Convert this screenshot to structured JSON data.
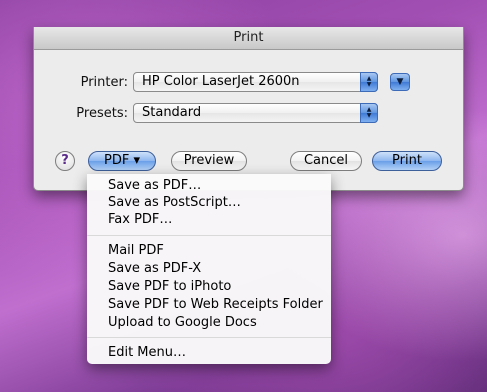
{
  "window": {
    "title": "Print"
  },
  "printer": {
    "label": "Printer:",
    "value": "HP Color LaserJet 2600n"
  },
  "presets": {
    "label": "Presets:",
    "value": "Standard"
  },
  "buttons": {
    "help": "?",
    "pdf": "PDF ▾",
    "preview": "Preview",
    "cancel": "Cancel",
    "print": "Print"
  },
  "pdf_menu": {
    "group1": [
      "Save as PDF…",
      "Save as PostScript…",
      "Fax PDF…"
    ],
    "group2": [
      "Mail PDF",
      "Save as PDF-X",
      "Save PDF to iPhoto",
      "Save PDF to Web Receipts Folder",
      "Upload to Google Docs"
    ],
    "group3": [
      "Edit Menu…"
    ]
  },
  "colors": {
    "accent_blue": "#6a9fe8",
    "sheet_bg": "#ececec"
  }
}
